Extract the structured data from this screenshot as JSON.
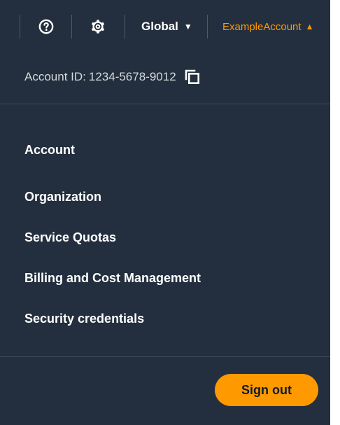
{
  "header": {
    "region_label": "Global",
    "account_label": "ExampleAccount"
  },
  "account": {
    "id_label": "Account ID:",
    "id_value": "1234-5678-9012"
  },
  "menu": {
    "items": [
      {
        "label": "Account"
      },
      {
        "label": "Organization"
      },
      {
        "label": "Service Quotas"
      },
      {
        "label": "Billing and Cost Management"
      },
      {
        "label": "Security credentials"
      }
    ]
  },
  "footer": {
    "sign_out_label": "Sign out"
  },
  "colors": {
    "panel_background": "#232f3e",
    "accent": "#ff9900",
    "text": "#ffffff",
    "muted_text": "#d5dbdb"
  },
  "icons": {
    "help": "help-circle-icon",
    "settings": "gear-icon",
    "region_caret": "caret-down-icon",
    "account_caret": "caret-up-icon",
    "copy": "copy-icon"
  }
}
